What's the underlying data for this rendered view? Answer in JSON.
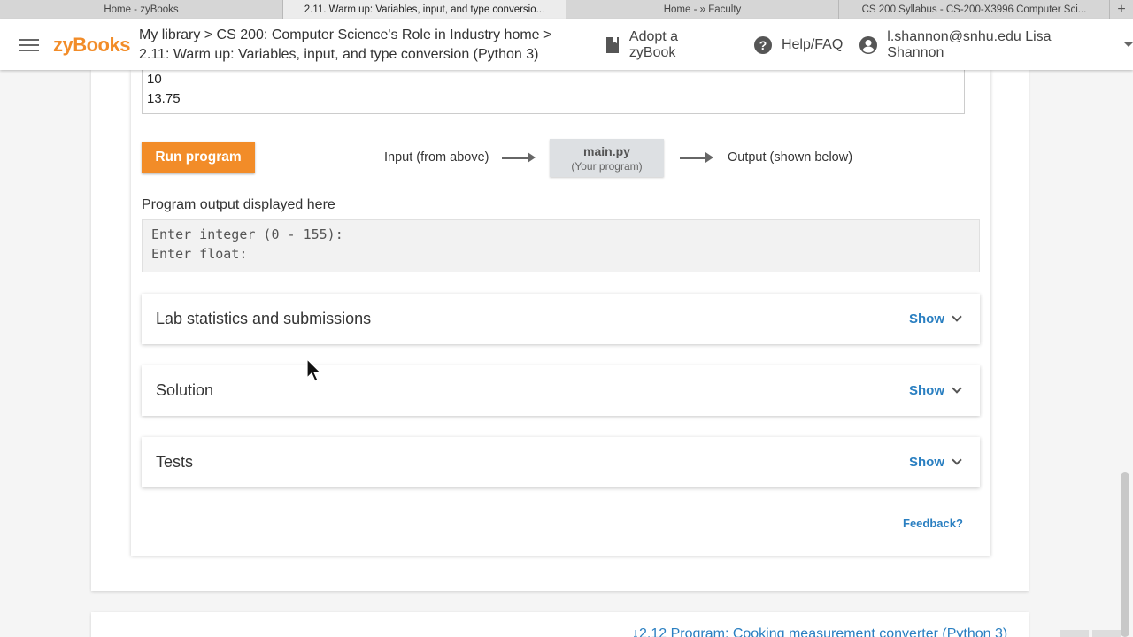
{
  "browser": {
    "tabs": [
      {
        "label": "Home - zyBooks",
        "active": false
      },
      {
        "label": "2.11. Warm up: Variables, input, and type conversio...",
        "active": true
      },
      {
        "label": "Home - » Faculty",
        "active": false
      },
      {
        "label": "CS 200 Syllabus - CS-200-X3996 Computer Sci...",
        "active": false
      }
    ],
    "new_tab": "+"
  },
  "header": {
    "logo": "zyBooks",
    "breadcrumb_line1": "My library > CS 200: Computer Science's Role in Industry home >",
    "breadcrumb_line2": "2.11: Warm up: Variables, input, and type conversion (Python 3)",
    "adopt_label": "Adopt a zyBook",
    "help_label": "Help/FAQ",
    "user_label": "l.shannon@snhu.edu Lisa Shannon"
  },
  "program_input": {
    "lines": [
      "10",
      "13.75"
    ]
  },
  "run": {
    "button_label": "Run program",
    "input_label": "Input (from above)",
    "file_name": "main.py",
    "file_sub": "(Your program)",
    "output_label": "Output (shown below)"
  },
  "output": {
    "title": "Program output displayed here",
    "lines": [
      "Enter integer (0 - 155):",
      "Enter float:"
    ]
  },
  "sections": [
    {
      "title": "Lab statistics and submissions",
      "action": "Show"
    },
    {
      "title": "Solution",
      "action": "Show"
    },
    {
      "title": "Tests",
      "action": "Show"
    }
  ],
  "feedback_label": "Feedback?",
  "next_section_link": "↓2.12 Program: Cooking measurement converter (Python 3)",
  "colors": {
    "brand_orange": "#f28c28",
    "link_blue": "#2a7fc1"
  }
}
